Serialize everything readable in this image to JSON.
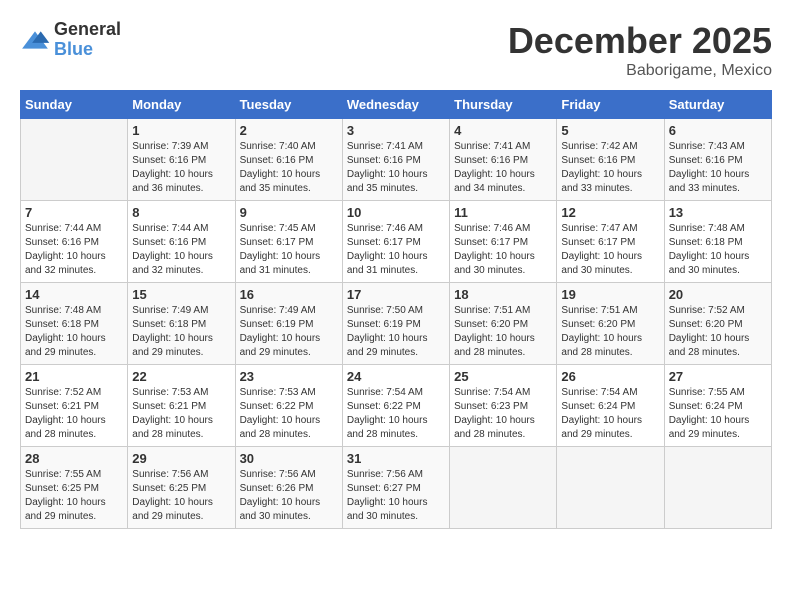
{
  "header": {
    "logo_general": "General",
    "logo_blue": "Blue",
    "month_year": "December 2025",
    "location": "Baborigame, Mexico"
  },
  "weekdays": [
    "Sunday",
    "Monday",
    "Tuesday",
    "Wednesday",
    "Thursday",
    "Friday",
    "Saturday"
  ],
  "weeks": [
    [
      {
        "day": "",
        "info": ""
      },
      {
        "day": "1",
        "info": "Sunrise: 7:39 AM\nSunset: 6:16 PM\nDaylight: 10 hours\nand 36 minutes."
      },
      {
        "day": "2",
        "info": "Sunrise: 7:40 AM\nSunset: 6:16 PM\nDaylight: 10 hours\nand 35 minutes."
      },
      {
        "day": "3",
        "info": "Sunrise: 7:41 AM\nSunset: 6:16 PM\nDaylight: 10 hours\nand 35 minutes."
      },
      {
        "day": "4",
        "info": "Sunrise: 7:41 AM\nSunset: 6:16 PM\nDaylight: 10 hours\nand 34 minutes."
      },
      {
        "day": "5",
        "info": "Sunrise: 7:42 AM\nSunset: 6:16 PM\nDaylight: 10 hours\nand 33 minutes."
      },
      {
        "day": "6",
        "info": "Sunrise: 7:43 AM\nSunset: 6:16 PM\nDaylight: 10 hours\nand 33 minutes."
      }
    ],
    [
      {
        "day": "7",
        "info": "Sunrise: 7:44 AM\nSunset: 6:16 PM\nDaylight: 10 hours\nand 32 minutes."
      },
      {
        "day": "8",
        "info": "Sunrise: 7:44 AM\nSunset: 6:16 PM\nDaylight: 10 hours\nand 32 minutes."
      },
      {
        "day": "9",
        "info": "Sunrise: 7:45 AM\nSunset: 6:17 PM\nDaylight: 10 hours\nand 31 minutes."
      },
      {
        "day": "10",
        "info": "Sunrise: 7:46 AM\nSunset: 6:17 PM\nDaylight: 10 hours\nand 31 minutes."
      },
      {
        "day": "11",
        "info": "Sunrise: 7:46 AM\nSunset: 6:17 PM\nDaylight: 10 hours\nand 30 minutes."
      },
      {
        "day": "12",
        "info": "Sunrise: 7:47 AM\nSunset: 6:17 PM\nDaylight: 10 hours\nand 30 minutes."
      },
      {
        "day": "13",
        "info": "Sunrise: 7:48 AM\nSunset: 6:18 PM\nDaylight: 10 hours\nand 30 minutes."
      }
    ],
    [
      {
        "day": "14",
        "info": "Sunrise: 7:48 AM\nSunset: 6:18 PM\nDaylight: 10 hours\nand 29 minutes."
      },
      {
        "day": "15",
        "info": "Sunrise: 7:49 AM\nSunset: 6:18 PM\nDaylight: 10 hours\nand 29 minutes."
      },
      {
        "day": "16",
        "info": "Sunrise: 7:49 AM\nSunset: 6:19 PM\nDaylight: 10 hours\nand 29 minutes."
      },
      {
        "day": "17",
        "info": "Sunrise: 7:50 AM\nSunset: 6:19 PM\nDaylight: 10 hours\nand 29 minutes."
      },
      {
        "day": "18",
        "info": "Sunrise: 7:51 AM\nSunset: 6:20 PM\nDaylight: 10 hours\nand 28 minutes."
      },
      {
        "day": "19",
        "info": "Sunrise: 7:51 AM\nSunset: 6:20 PM\nDaylight: 10 hours\nand 28 minutes."
      },
      {
        "day": "20",
        "info": "Sunrise: 7:52 AM\nSunset: 6:20 PM\nDaylight: 10 hours\nand 28 minutes."
      }
    ],
    [
      {
        "day": "21",
        "info": "Sunrise: 7:52 AM\nSunset: 6:21 PM\nDaylight: 10 hours\nand 28 minutes."
      },
      {
        "day": "22",
        "info": "Sunrise: 7:53 AM\nSunset: 6:21 PM\nDaylight: 10 hours\nand 28 minutes."
      },
      {
        "day": "23",
        "info": "Sunrise: 7:53 AM\nSunset: 6:22 PM\nDaylight: 10 hours\nand 28 minutes."
      },
      {
        "day": "24",
        "info": "Sunrise: 7:54 AM\nSunset: 6:22 PM\nDaylight: 10 hours\nand 28 minutes."
      },
      {
        "day": "25",
        "info": "Sunrise: 7:54 AM\nSunset: 6:23 PM\nDaylight: 10 hours\nand 28 minutes."
      },
      {
        "day": "26",
        "info": "Sunrise: 7:54 AM\nSunset: 6:24 PM\nDaylight: 10 hours\nand 29 minutes."
      },
      {
        "day": "27",
        "info": "Sunrise: 7:55 AM\nSunset: 6:24 PM\nDaylight: 10 hours\nand 29 minutes."
      }
    ],
    [
      {
        "day": "28",
        "info": "Sunrise: 7:55 AM\nSunset: 6:25 PM\nDaylight: 10 hours\nand 29 minutes."
      },
      {
        "day": "29",
        "info": "Sunrise: 7:56 AM\nSunset: 6:25 PM\nDaylight: 10 hours\nand 29 minutes."
      },
      {
        "day": "30",
        "info": "Sunrise: 7:56 AM\nSunset: 6:26 PM\nDaylight: 10 hours\nand 30 minutes."
      },
      {
        "day": "31",
        "info": "Sunrise: 7:56 AM\nSunset: 6:27 PM\nDaylight: 10 hours\nand 30 minutes."
      },
      {
        "day": "",
        "info": ""
      },
      {
        "day": "",
        "info": ""
      },
      {
        "day": "",
        "info": ""
      }
    ]
  ]
}
